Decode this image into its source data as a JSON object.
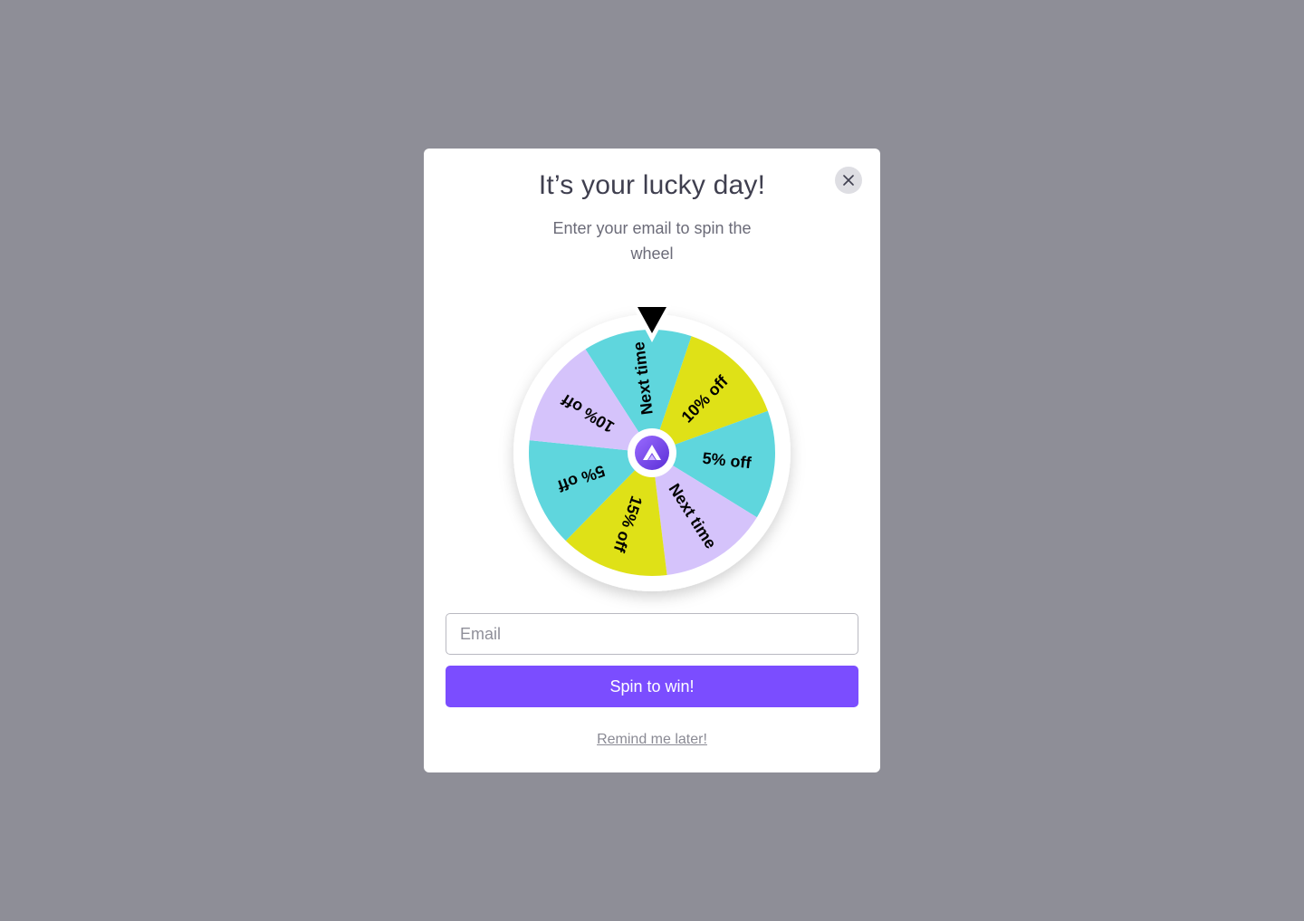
{
  "modal": {
    "title": "It’s your lucky day!",
    "subtitle": "Enter your email to spin the wheel",
    "close_icon": "close-icon"
  },
  "wheel": {
    "segments": [
      {
        "label": "Next time",
        "color": "#5fd6dd"
      },
      {
        "label": "10% off",
        "color": "#dfe117"
      },
      {
        "label": "5% off",
        "color": "#5fd6dd"
      },
      {
        "label": "Next time",
        "color": "#d5c3fb"
      },
      {
        "label": "15% off",
        "color": "#dfe117"
      },
      {
        "label": "5% off",
        "color": "#5fd6dd"
      },
      {
        "label": "10% off",
        "color": "#d5c3fb"
      }
    ],
    "pointer_icon": "pointer-triangle-icon",
    "center_icon": "brand-logo-icon",
    "center_color": "#7b4dff"
  },
  "form": {
    "email_placeholder": "Email",
    "spin_label": "Spin to win!",
    "remind_label": "Remind me later!"
  },
  "colors": {
    "overlay": "#8e8e97",
    "accent": "#7b4dff"
  }
}
